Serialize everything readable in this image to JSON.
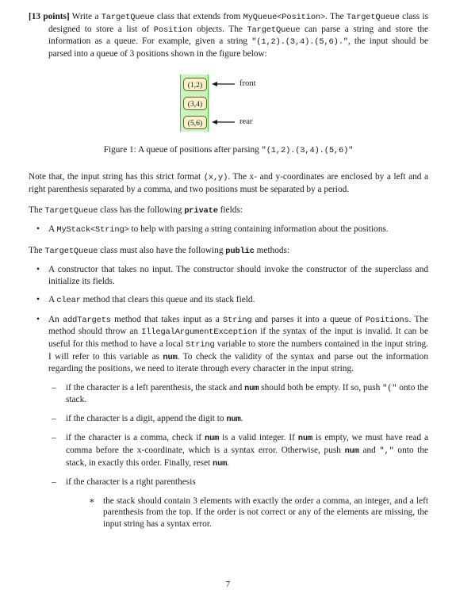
{
  "document": {
    "page_number": "7",
    "problem": {
      "points_label": "[13 points]",
      "intro_parts": [
        "Write a ",
        "TargetQueue",
        " class that extends from ",
        "MyQueue<Position>",
        ". The ",
        "TargetQueue",
        " class is designed to store a list of ",
        "Position",
        " objects. The ",
        "TargetQueue",
        " can parse a string and store the information as a queue. For example, given a string ",
        "\"(1,2).(3,4).(5,6).\"",
        ", the input should be parsed into a queue of 3 positions shown in the figure below:"
      ]
    },
    "figure": {
      "caption_prefix": "Figure 1: A queue of positions after parsing ",
      "caption_code": "\"(1,2).(3,4).(5,6)\"",
      "cells": [
        "(1,2)",
        "(3,4)",
        "(5,6)"
      ],
      "front_label": "front",
      "rear_label": "rear",
      "colors": {
        "band_fill": "#c8f5c0",
        "band_border": "#4ec94e",
        "cell_fill": "#f7f2c8",
        "cell_border": "#6b5a1e"
      }
    },
    "note_paragraph": {
      "p1": "Note that, the input string has this strict format ",
      "code1": "(x,y)",
      "p2": ". The x- and y-coordinates are enclosed by a left and a right parenthesis separated by a comma, and two positions must be separated by a period."
    },
    "private_fields_heading": {
      "p1": "The ",
      "code1": "TargetQueue",
      "p2": " class has the following ",
      "code2": "private",
      "p3": " fields:"
    },
    "private_fields": [
      {
        "marker": "•",
        "p1": "A ",
        "code1": "MyStack<String>",
        "p2": " to help with parsing a string containing information about the positions."
      }
    ],
    "public_methods_heading": {
      "p1": "The ",
      "code1": "TargetQueue",
      "p2": " class must also have the following ",
      "code2": "public",
      "p3": " methods:"
    },
    "public_methods": [
      {
        "marker": "•",
        "text": "A constructor that takes no input. The constructor should invoke the constructor of the superclass and initialize its fields."
      },
      {
        "marker": "•",
        "p1": "A ",
        "code1": "clear",
        "p2": " method that clears this queue and its stack field."
      },
      {
        "marker": "•",
        "p1": "An ",
        "code1": "addTargets",
        "p2": " method that takes input as a ",
        "code2": "String",
        "p3": " and parses it into a queue of ",
        "code3": "Positions",
        "p4": ". The method should throw an ",
        "code4": "IllegalArgumentException",
        "p5": " if the syntax of the input is invalid. It can be useful for this method to have a local ",
        "code5": "String",
        "p6": " variable to store the numbers contained in the input string. I will refer to this variable as ",
        "code6": "num",
        "p7": ". To check the validity of the syntax and parse out the information regarding the positions, we need to iterate through every character in the input string."
      }
    ],
    "sub_items": [
      {
        "marker": "–",
        "p1": "if the character is a left parenthesis, the stack and ",
        "code1": "num",
        "p2": " should both be empty. If so, push ",
        "code2": "\"(\"",
        "p3": " onto the stack."
      },
      {
        "marker": "–",
        "p1": "if the character is a digit, append the digit to ",
        "code1": "num",
        "p2": "."
      },
      {
        "marker": "–",
        "p1": "if the character is a comma, check if ",
        "code1": "num",
        "p2": " is a valid integer. If ",
        "code2": "num",
        "p3": " is empty, we must have read a comma before the x-coordinate, which is a syntax error. Otherwise, push ",
        "code3": "num",
        "p4": " and ",
        "code4": "\",\"",
        "p5": " onto the stack, in exactly this order. Finally, reset ",
        "code5": "num",
        "p6": "."
      },
      {
        "marker": "–",
        "p1": "if the character is a right parenthesis",
        "children": [
          {
            "marker": "∗",
            "text": "the stack should contain 3 elements with exactly the order a comma, an integer, and a left parenthesis from the top. If the order is not correct or any of the elements are missing, the input string has a syntax error."
          }
        ]
      }
    ]
  }
}
